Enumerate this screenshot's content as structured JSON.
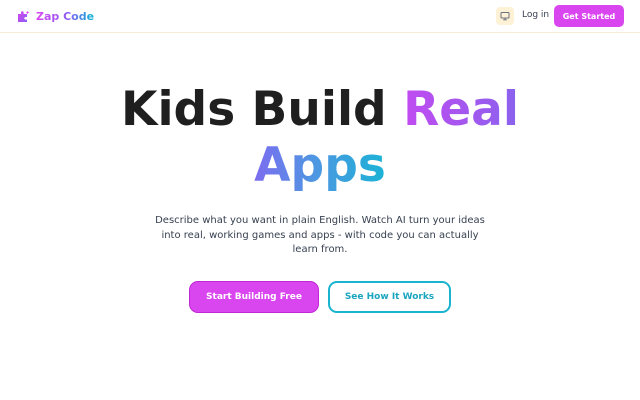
{
  "navbar": {
    "brand_name": "Zap Code",
    "brand_icon": "puzzle-sparkle-icon",
    "theme_icon": "monitor-icon",
    "login_label": "Log in",
    "get_started_label": "Get Started"
  },
  "hero": {
    "title_part1": "Kids Build ",
    "title_part2": "Real",
    "title_part3": "Apps",
    "description": "Describe what you want in plain English. Watch AI turn your ideas into real, working games and apps - with code you can actually learn from.",
    "primary_cta_label": "Start Building Free",
    "secondary_cta_label": "See How It Works"
  },
  "colors": {
    "accent_magenta": "#d946ef",
    "accent_violet": "#8b5cf6",
    "accent_cyan": "#06b6d4",
    "title_dark": "#1f1f1f",
    "theme_button_bg": "#fdf1d6"
  }
}
